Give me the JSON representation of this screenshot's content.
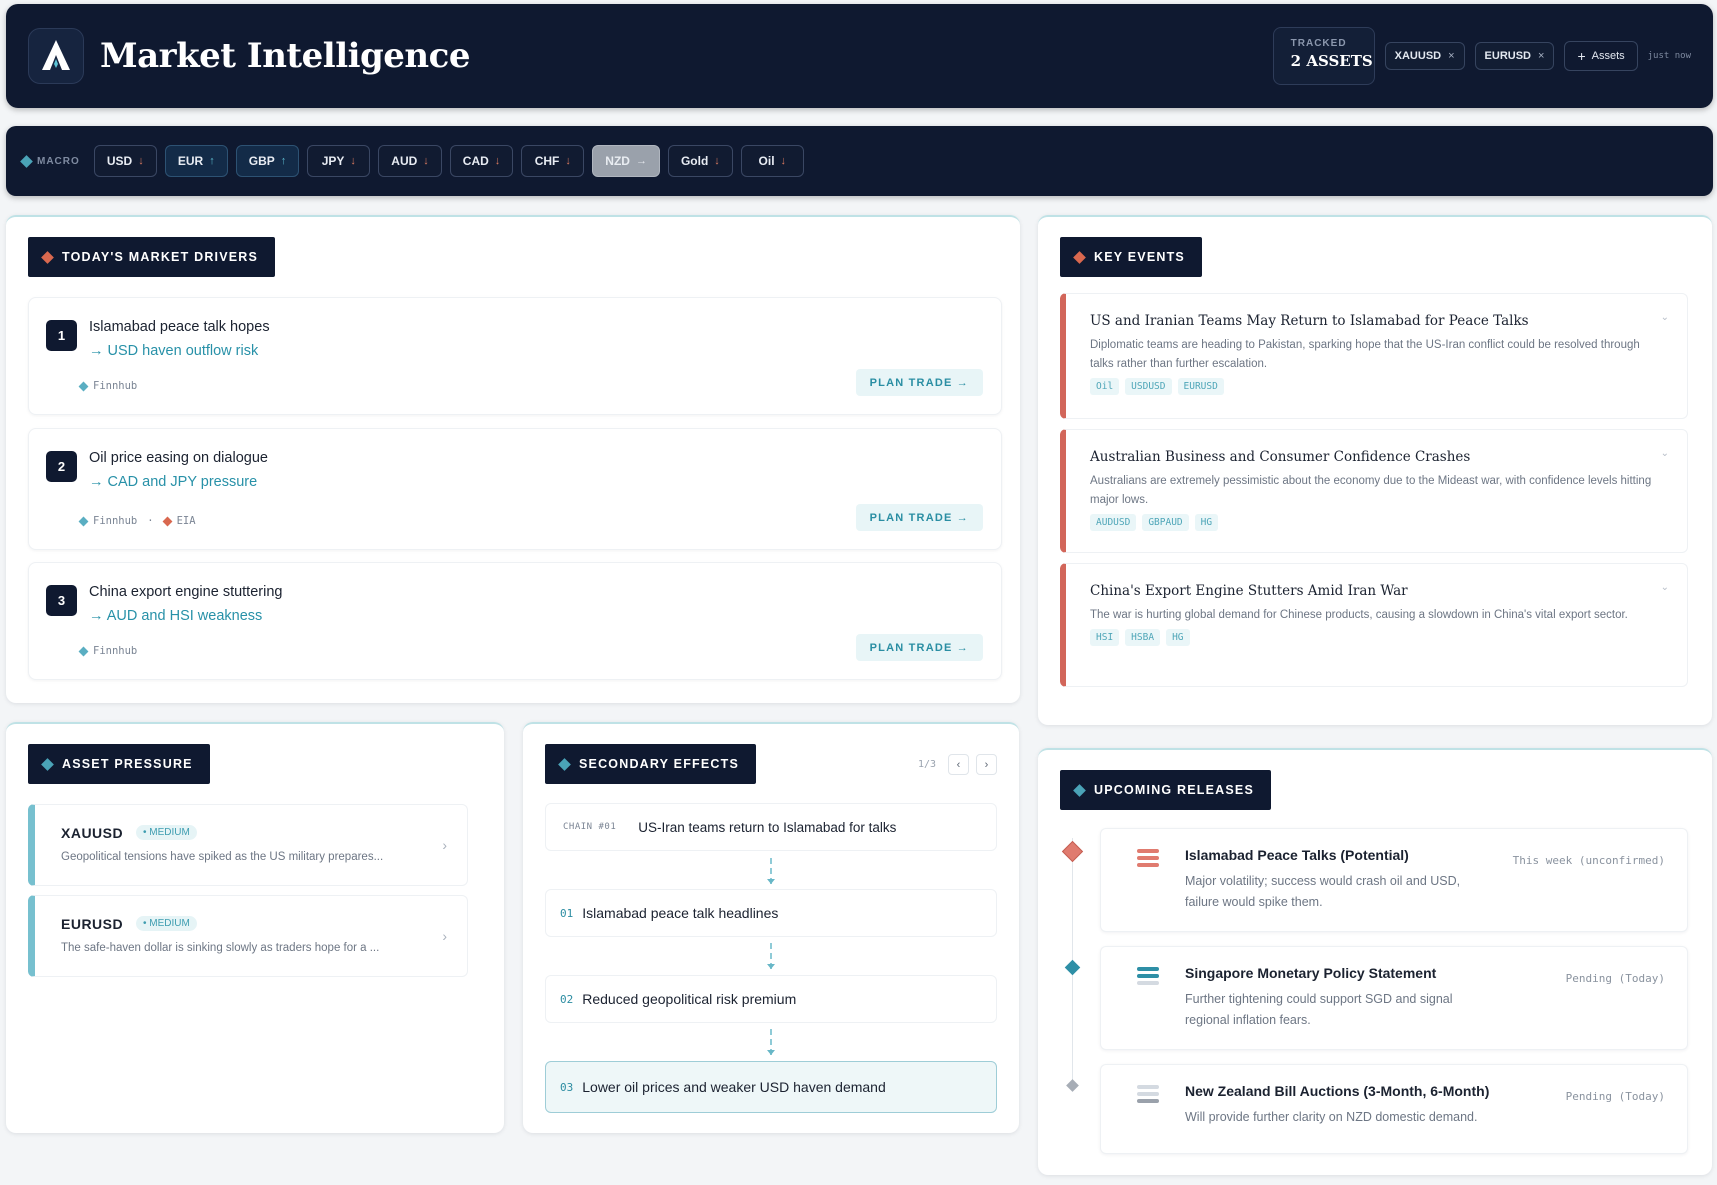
{
  "header": {
    "title": "Market Intelligence",
    "tracked_label": "TRACKED",
    "tracked_value": "2 ASSETS",
    "assets": [
      {
        "symbol": "XAUUSD",
        "remove": "×"
      },
      {
        "symbol": "EURUSD",
        "remove": "×"
      }
    ],
    "add_assets_label": "Assets",
    "add_icon": "+",
    "updated": "just now"
  },
  "macro": {
    "label": "MACRO",
    "currencies": [
      {
        "code": "USD",
        "arrow": "↓",
        "trend": "down"
      },
      {
        "code": "EUR",
        "arrow": "↑",
        "trend": "up"
      },
      {
        "code": "GBP",
        "arrow": "↑",
        "trend": "up"
      },
      {
        "code": "JPY",
        "arrow": "↓",
        "trend": "down"
      },
      {
        "code": "AUD",
        "arrow": "↓",
        "trend": "down"
      },
      {
        "code": "CAD",
        "arrow": "↓",
        "trend": "down"
      },
      {
        "code": "CHF",
        "arrow": "↓",
        "trend": "down"
      },
      {
        "code": "NZD",
        "arrow": "→",
        "trend": "flat",
        "selected": true
      },
      {
        "code": "Gold",
        "arrow": "↓",
        "trend": "down"
      },
      {
        "code": "Oil",
        "arrow": "↓",
        "trend": "down"
      }
    ]
  },
  "drivers": {
    "heading": "TODAY'S MARKET DRIVERS",
    "plan_trade_label": "PLAN TRADE →",
    "items": [
      {
        "num": "1",
        "title": "Islamabad peace talk hopes",
        "impact": "→ USD haven outflow risk",
        "sources": [
          "Finnhub"
        ]
      },
      {
        "num": "2",
        "title": "Oil price easing on dialogue",
        "impact": "→ CAD and JPY pressure",
        "sources": [
          "Finnhub",
          "EIA"
        ],
        "separator": "·"
      },
      {
        "num": "3",
        "title": "China export engine stuttering",
        "impact": "→ AUD and HSI weakness",
        "sources": [
          "Finnhub"
        ]
      }
    ]
  },
  "key_events": {
    "heading": "KEY EVENTS",
    "items": [
      {
        "title": "US and Iranian Teams May Return to Islamabad for Peace Talks",
        "desc": "Diplomatic teams are heading to Pakistan, sparking hope that the US-Iran conflict could be resolved through talks rather than further escalation.",
        "tags": [
          "Oil",
          "USDUSD",
          "EURUSD"
        ]
      },
      {
        "title": "Australian Business and Consumer Confidence Crashes",
        "desc": "Australians are extremely pessimistic about the economy due to the Mideast war, with confidence levels hitting major lows.",
        "tags": [
          "AUDUSD",
          "GBPAUD",
          "HG"
        ]
      },
      {
        "title": "China's Export Engine Stutters Amid Iran War",
        "desc": "The war is hurting global demand for Chinese products, causing a slowdown in China's vital export sector.",
        "tags": [
          "HSI",
          "HSBA",
          "HG"
        ]
      }
    ]
  },
  "asset_pressure": {
    "heading": "ASSET PRESSURE",
    "items": [
      {
        "symbol": "XAUUSD",
        "badge": "• MEDIUM",
        "desc": "Geopolitical tensions have spiked as the US military prepares..."
      },
      {
        "symbol": "EURUSD",
        "badge": "• MEDIUM",
        "desc": "The safe-haven dollar is sinking slowly as traders hope for a ..."
      }
    ]
  },
  "secondary_effects": {
    "heading": "SECONDARY EFFECTS",
    "pager": "1/3",
    "prev": "‹",
    "next": "›",
    "chain_id": "CHAIN #01",
    "chain_title": "US-Iran teams return to Islamabad for talks",
    "steps": [
      {
        "num": "01",
        "label": "Islamabad peace talk headlines"
      },
      {
        "num": "02",
        "label": "Reduced geopolitical risk premium"
      },
      {
        "num": "03",
        "label": "Lower oil prices and weaker USD haven demand"
      }
    ]
  },
  "releases": {
    "heading": "UPCOMING RELEASES",
    "items": [
      {
        "title": "Islamabad Peace Talks (Potential)",
        "desc": "Major volatility; success would crash oil and USD, failure would spike them.",
        "time": "This week (unconfirmed)",
        "importance": "high"
      },
      {
        "title": "Singapore Monetary Policy Statement",
        "desc": "Further tightening could support SGD and signal regional inflation fears.",
        "time": "Pending (Today)",
        "importance": "medium"
      },
      {
        "title": "New Zealand Bill Auctions (3-Month, 6-Month)",
        "desc": "Will provide further clarity on NZD domestic demand.",
        "time": "Pending (Today)",
        "importance": "low"
      }
    ]
  },
  "colors": {
    "navy": "#0f1930",
    "teal": "#2891a8",
    "red": "#d2665a",
    "light_teal": "#77c0cf"
  }
}
